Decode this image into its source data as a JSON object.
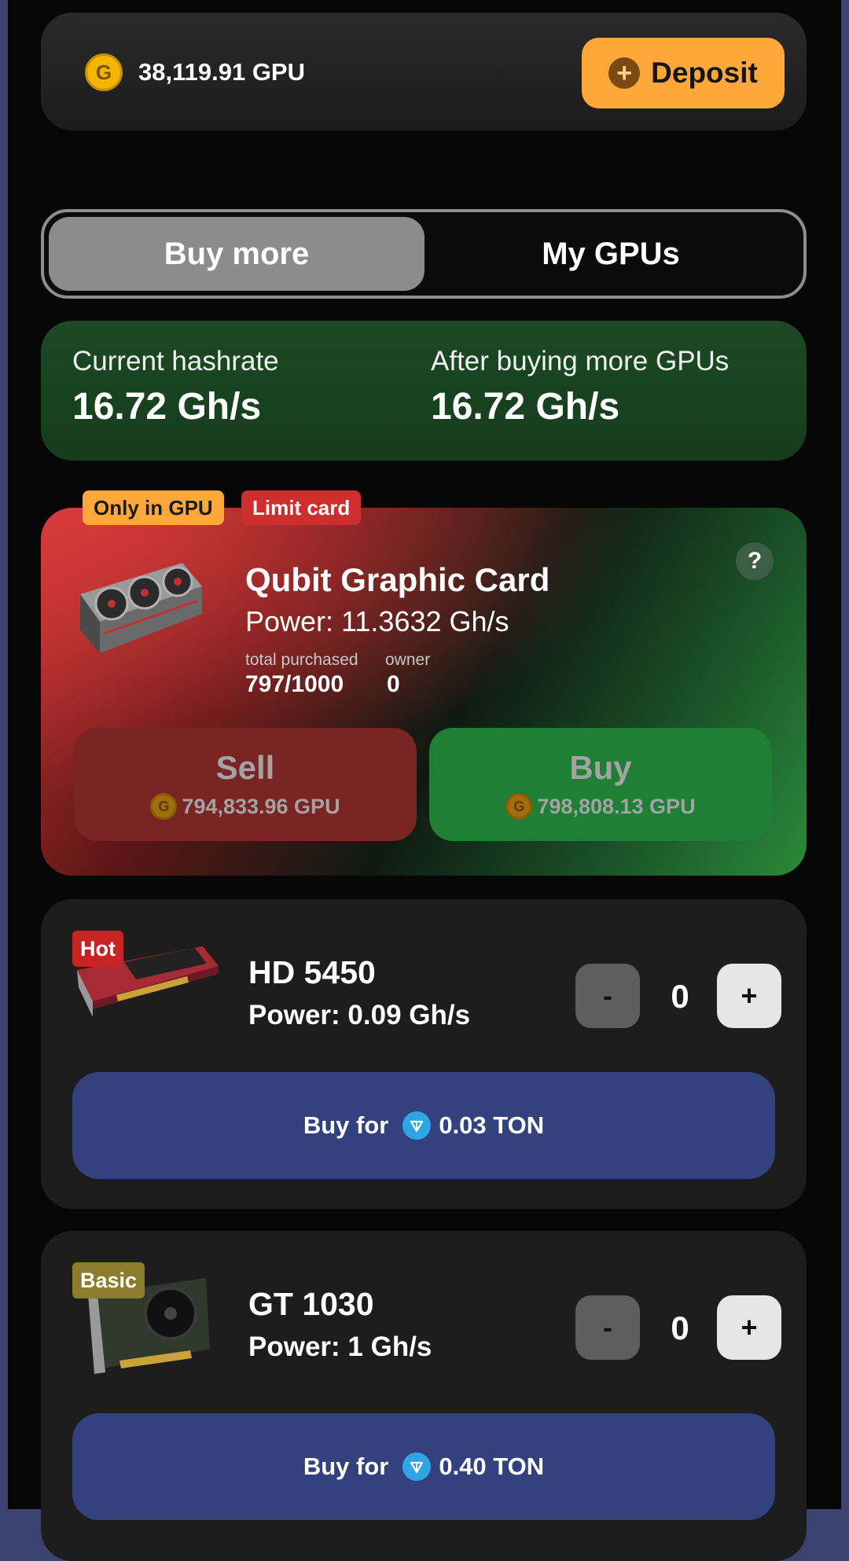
{
  "balance": {
    "coin_letter": "G",
    "text": "38,119.91 GPU"
  },
  "deposit": {
    "label": "Deposit"
  },
  "tabs": [
    {
      "label": "Buy more",
      "active": true
    },
    {
      "label": "My GPUs",
      "active": false
    }
  ],
  "hashrate": {
    "current_label": "Current hashrate",
    "current_value": "16.72 Gh/s",
    "after_label": "After buying more GPUs",
    "after_value": "16.72 Gh/s"
  },
  "special_card": {
    "badges": [
      "Only in GPU",
      "Limit card"
    ],
    "title": "Qubit Graphic Card",
    "power": "Power: 11.3632 Gh/s",
    "purchased_label": "total purchased",
    "purchased_value": "797/1000",
    "owner_label": "owner",
    "owner_value": "0",
    "help": "?",
    "sell_label": "Sell",
    "sell_price": "794,833.96 GPU",
    "buy_label": "Buy",
    "buy_price": "798,808.13 GPU"
  },
  "gpus": [
    {
      "badge": "Hot",
      "badge_color": "#c92424",
      "name": "HD 5450",
      "power": "Power: 0.09 Gh/s",
      "qty": "0",
      "minus": "-",
      "plus": "+",
      "buy_prefix": "Buy for",
      "price": "0.03 TON"
    },
    {
      "badge": "Basic",
      "badge_color": "#8c7d2e",
      "name": "GT 1030",
      "power": "Power: 1 Gh/s",
      "qty": "0",
      "minus": "-",
      "plus": "+",
      "buy_prefix": "Buy for",
      "price": "0.40 TON"
    }
  ]
}
